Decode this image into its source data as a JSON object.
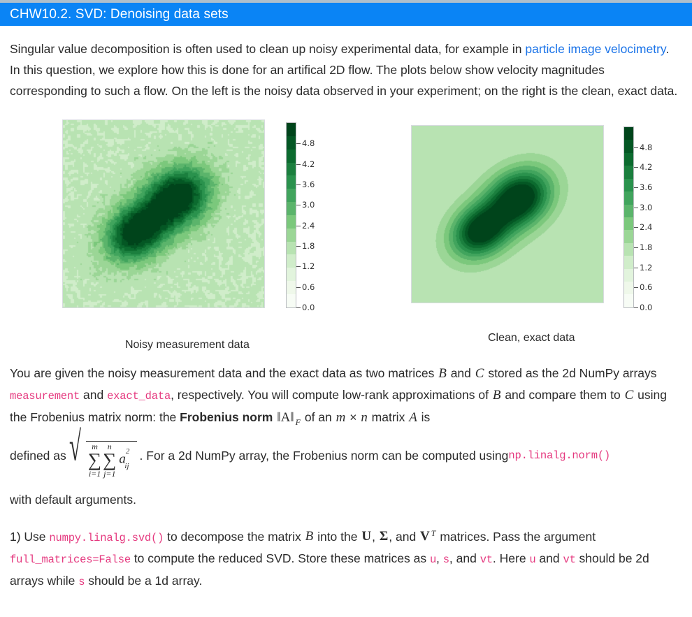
{
  "header": {
    "title": "CHW10.2. SVD: Denoising data sets",
    "bg_color": "#0a84f5",
    "text_color": "#ffffff"
  },
  "colors": {
    "link": "#1a73e8",
    "code": "#e5397f",
    "body_text": "#2b2b2b",
    "page_bg": "#ffffff"
  },
  "intro": {
    "seg1": "Singular value decomposition is often used to clean up noisy experimental data, for example in ",
    "link_text": "particle image velocimetry",
    "seg2": ". In this question, we explore how this is done for an artifical 2D flow. The plots below show velocity magnitudes corresponding to such a flow. On the left is the noisy data observed in your experiment; on the right is the clean, exact data."
  },
  "figures": {
    "left": {
      "caption": "Noisy measurement data",
      "colorbar": {
        "ticks": [
          "4.8",
          "4.2",
          "3.6",
          "3.0",
          "2.4",
          "1.8",
          "1.2",
          "0.6",
          "0.0"
        ],
        "min": 0.0,
        "max": 5.4
      }
    },
    "right": {
      "caption": "Clean, exact data",
      "colorbar": {
        "ticks": [
          "4.8",
          "4.2",
          "3.6",
          "3.0",
          "2.4",
          "1.8",
          "1.2",
          "0.6",
          "0.0"
        ],
        "min": 0.0,
        "max": 5.4
      }
    },
    "colormap_name": "Greens",
    "colormap_levels": [
      "#f7fcf5",
      "#eff8ea",
      "#e2f4dd",
      "#d0edca",
      "#b8e3b2",
      "#9bd696",
      "#7bc87c",
      "#5bb46b",
      "#41a45d",
      "#2a924d",
      "#1b7f3e",
      "#0c6b2f",
      "#045724",
      "#00441b"
    ],
    "background_level": "#58b265"
  },
  "para2": {
    "t1": "You are given the noisy measurement data and the exact data as two matrices ",
    "m_B": "B",
    "t2": " and ",
    "m_C": "C",
    "t3": " stored as the 2d NumPy arrays ",
    "code1": "measurement",
    "t4": " and ",
    "code2": "exact_data",
    "t5": ", respectively. You will compute low-rank approximations of ",
    "m_B2": "B",
    "t6": " and compare them to ",
    "m_C2": "C",
    "t7": " using the Frobenius matrix norm: the ",
    "bold1": "Frobenius norm",
    "t8": " ",
    "norm_sym": "‖A‖",
    "norm_sub": "F",
    "t9": " of an ",
    "m_m": "m",
    "t10": " × ",
    "m_n": "n",
    "t11": " matrix ",
    "m_A": "A",
    "t12": " is"
  },
  "formula": {
    "lead": "defined as",
    "sum1_top": "m",
    "sum1_bot": "i=1",
    "sum2_top": "n",
    "sum2_bot": "j=1",
    "term_base": "a",
    "term_sup": "2",
    "term_sub": "ij",
    "trail": ". For a 2d NumPy array, the Frobenius norm can be computed using ",
    "code": "np.linalg.norm()",
    "after": "with default arguments."
  },
  "para3": {
    "t1": "1) Use ",
    "code1": "numpy.linalg.svd()",
    "t2": " to decompose the matrix ",
    "m_B": "B",
    "t3": " into the ",
    "m_U": "U",
    "t4": ", ",
    "m_Sigma": "Σ",
    "t5": ", and ",
    "m_VT": "V",
    "m_VT_sup": "T",
    "t6": " matrices. Pass the argument ",
    "code2": "full_matrices=False",
    "t7": " to compute the reduced SVD. Store these matrices as ",
    "code3": "u",
    "t8": ", ",
    "code4": "s",
    "t9": ", and ",
    "code5": "vt",
    "t10": ". Here ",
    "code6": "u",
    "t11": " and ",
    "code7": "vt",
    "t12": " should be 2d arrays while ",
    "code8": "s",
    "t13": " should be a 1d array."
  }
}
